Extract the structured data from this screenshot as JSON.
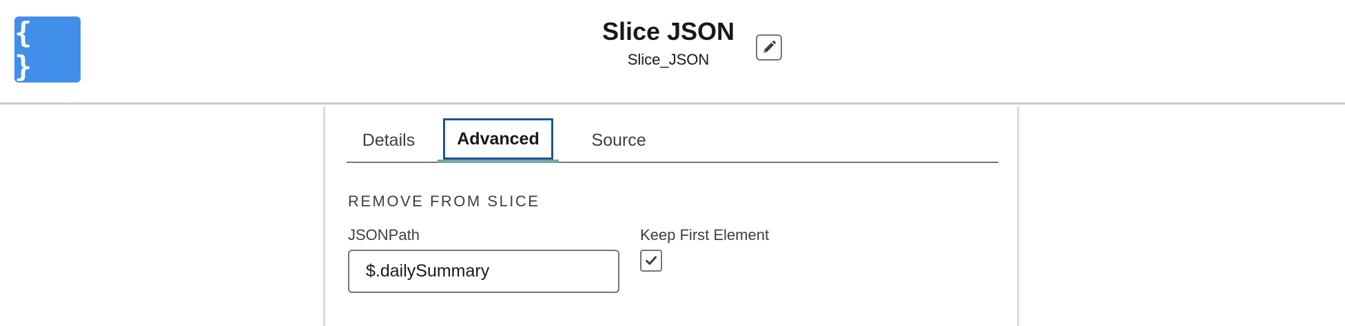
{
  "header": {
    "app_icon_glyph": "{ }",
    "title": "Slice JSON",
    "api_name": "Slice_JSON",
    "edit_icon": "pencil-icon"
  },
  "tabs": [
    {
      "label": "Details",
      "active": false
    },
    {
      "label": "Advanced",
      "active": true
    },
    {
      "label": "Source",
      "active": false
    }
  ],
  "section": {
    "heading": "REMOVE FROM SLICE",
    "jsonpath_label": "JSONPath",
    "jsonpath_value": "$.dailySummary",
    "keep_first_label": "Keep First Element",
    "keep_first_checked": true,
    "check_icon": "checkmark-icon"
  },
  "colors": {
    "app_icon_bg": "#418fea",
    "focus_border": "#1b5297",
    "active_tab_underline": "#70a8a0",
    "text": "#181818"
  }
}
